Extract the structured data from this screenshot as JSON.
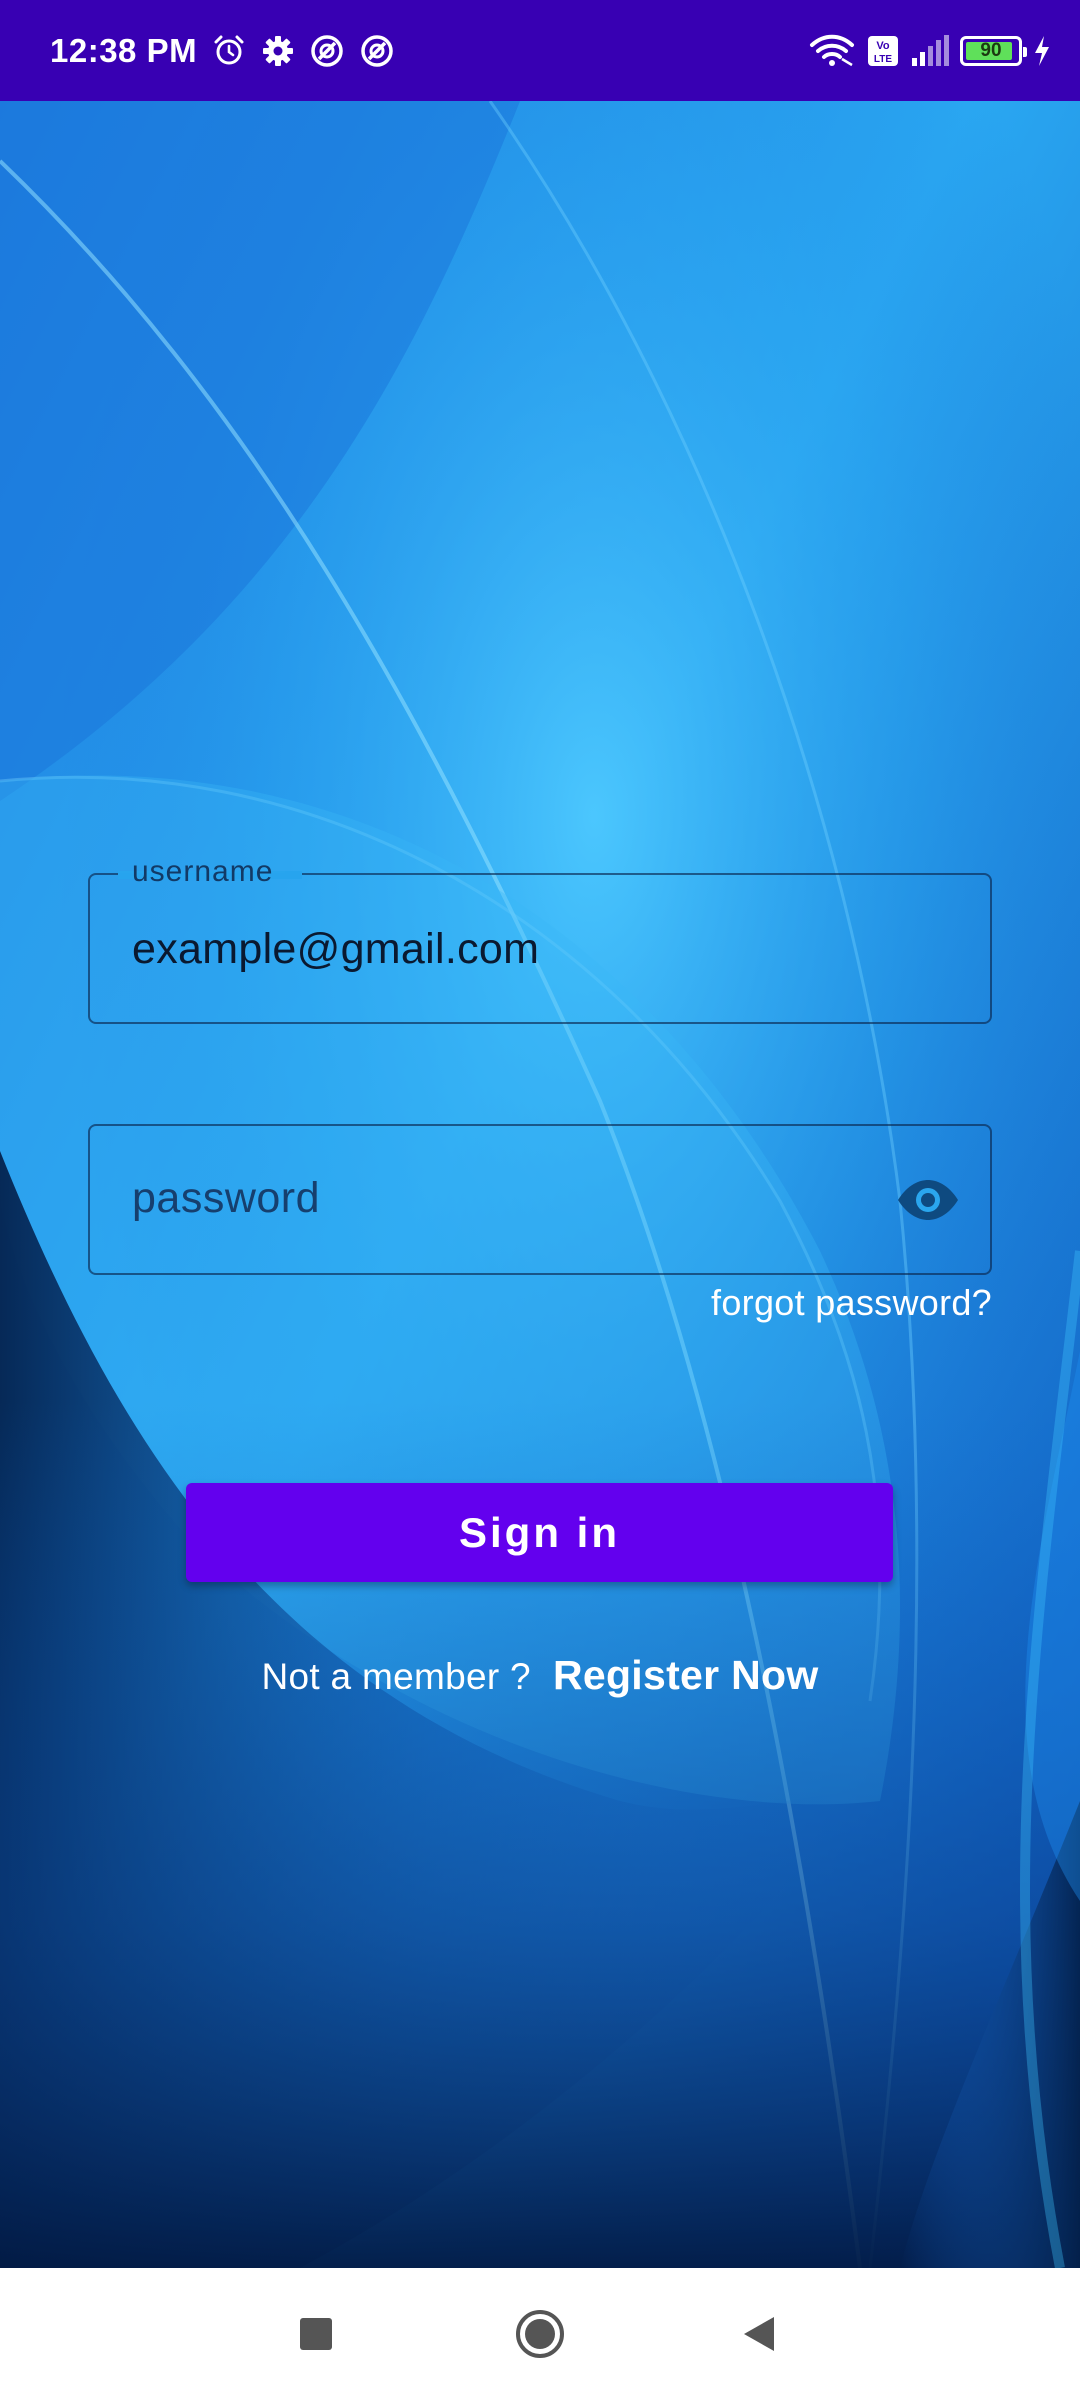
{
  "status_bar": {
    "time": "12:38 PM",
    "battery_level": "90",
    "left_icons": [
      "alarm-icon",
      "settings-icon",
      "vpn-icon",
      "vpn-icon"
    ],
    "right_icons": [
      "wifi-icon",
      "volte-icon",
      "signal-icon",
      "battery-icon",
      "charging-icon"
    ]
  },
  "login_form": {
    "username": {
      "label": "username",
      "value": "example@gmail.com"
    },
    "password": {
      "placeholder": "password",
      "toggle_icon": "eye-icon"
    },
    "forgot_password": "forgot password?",
    "sign_in": "Sign in",
    "not_member": "Not a member ?",
    "register": "Register Now"
  },
  "nav_bar": {
    "buttons": [
      "recents-icon",
      "home-icon",
      "back-icon"
    ]
  },
  "colors": {
    "status_bar": "#3800b3",
    "primary_button": "#6300ee",
    "background_blue": "#1a6fd8",
    "nav_bar": "#ffffff"
  }
}
